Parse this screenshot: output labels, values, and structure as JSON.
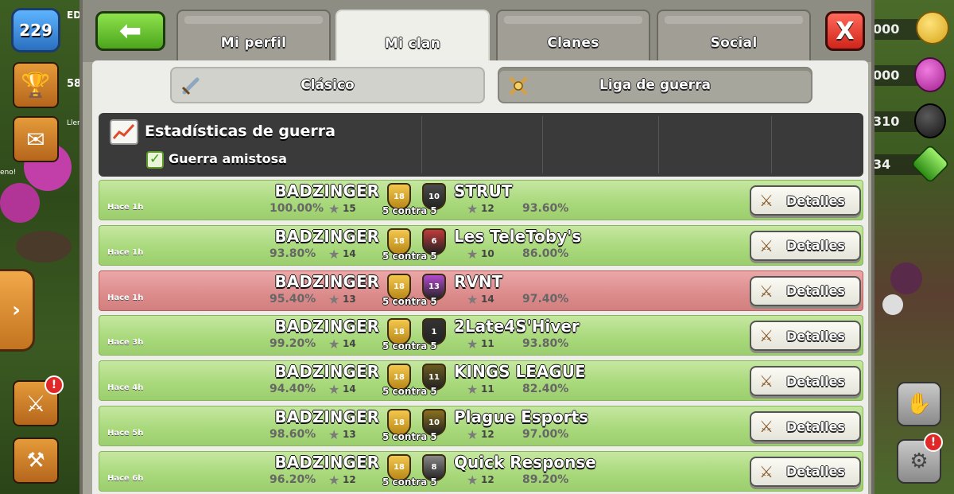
{
  "hud": {
    "level": "229",
    "left_partial_a": "ED",
    "left_partial_b": "58",
    "left_partial_c": "Llen",
    "left_partial_d": "eno!",
    "resources": [
      "000",
      "000",
      "310",
      "34"
    ],
    "attack_notif": "!",
    "settings_notif": "!"
  },
  "tabs": {
    "back_icon": "back-arrow-icon",
    "items": [
      {
        "label": "Mi perfil",
        "active": false
      },
      {
        "label": "Mi clan",
        "active": true
      },
      {
        "label": "Clanes",
        "active": false
      },
      {
        "label": "Social",
        "active": false
      }
    ],
    "close_label": "X"
  },
  "subtabs": {
    "classic": "Clásico",
    "war_league": "Liga de guerra"
  },
  "stats": {
    "title": "Estadísticas de guerra",
    "friendly_label": "Guerra amistosa",
    "friendly_checked": true
  },
  "war_log": [
    {
      "result": "win",
      "time": "Hace 1h",
      "our_clan": "BADZINGER",
      "our_pct": "100.00%",
      "our_stars": "15",
      "our_level": "18",
      "size": "5 contra 5",
      "enemy_clan": "STRUT",
      "enemy_pct": "93.60%",
      "enemy_stars": "12",
      "enemy_level": "10",
      "details": "Detalles"
    },
    {
      "result": "win",
      "time": "Hace 1h",
      "our_clan": "BADZINGER",
      "our_pct": "93.80%",
      "our_stars": "14",
      "our_level": "18",
      "size": "5 contra 5",
      "enemy_clan": "Les TeleToby's",
      "enemy_pct": "86.00%",
      "enemy_stars": "10",
      "enemy_level": "6",
      "details": "Detalles"
    },
    {
      "result": "loss",
      "time": "Hace 1h",
      "our_clan": "BADZINGER",
      "our_pct": "95.40%",
      "our_stars": "13",
      "our_level": "18",
      "size": "5 contra 5",
      "enemy_clan": "RVNT",
      "enemy_pct": "97.40%",
      "enemy_stars": "14",
      "enemy_level": "13",
      "details": "Detalles"
    },
    {
      "result": "win",
      "time": "Hace 3h",
      "our_clan": "BADZINGER",
      "our_pct": "99.20%",
      "our_stars": "14",
      "our_level": "18",
      "size": "5 contra 5",
      "enemy_clan": "2Late4S'Hiver",
      "enemy_pct": "93.80%",
      "enemy_stars": "11",
      "enemy_level": "1",
      "details": "Detalles"
    },
    {
      "result": "win",
      "time": "Hace 4h",
      "our_clan": "BADZINGER",
      "our_pct": "94.40%",
      "our_stars": "14",
      "our_level": "18",
      "size": "5 contra 5",
      "enemy_clan": "KINGS LEAGUE",
      "enemy_pct": "82.40%",
      "enemy_stars": "11",
      "enemy_level": "11",
      "details": "Detalles"
    },
    {
      "result": "win",
      "time": "Hace 5h",
      "our_clan": "BADZINGER",
      "our_pct": "98.60%",
      "our_stars": "13",
      "our_level": "18",
      "size": "5 contra 5",
      "enemy_clan": "Plague Esports",
      "enemy_pct": "97.00%",
      "enemy_stars": "12",
      "enemy_level": "10",
      "details": "Detalles"
    },
    {
      "result": "win",
      "time": "Hace 6h",
      "our_clan": "BADZINGER",
      "our_pct": "96.20%",
      "our_stars": "12",
      "our_level": "18",
      "size": "5 contra 5",
      "enemy_clan": "Quick Response",
      "enemy_pct": "89.20%",
      "enemy_stars": "12",
      "enemy_level": "8",
      "details": "Detalles"
    }
  ],
  "colors": {
    "win_row": "#a7d879",
    "loss_row": "#dc8b8b",
    "back_button": "#5cb82a",
    "close_button": "#e03a2c"
  }
}
